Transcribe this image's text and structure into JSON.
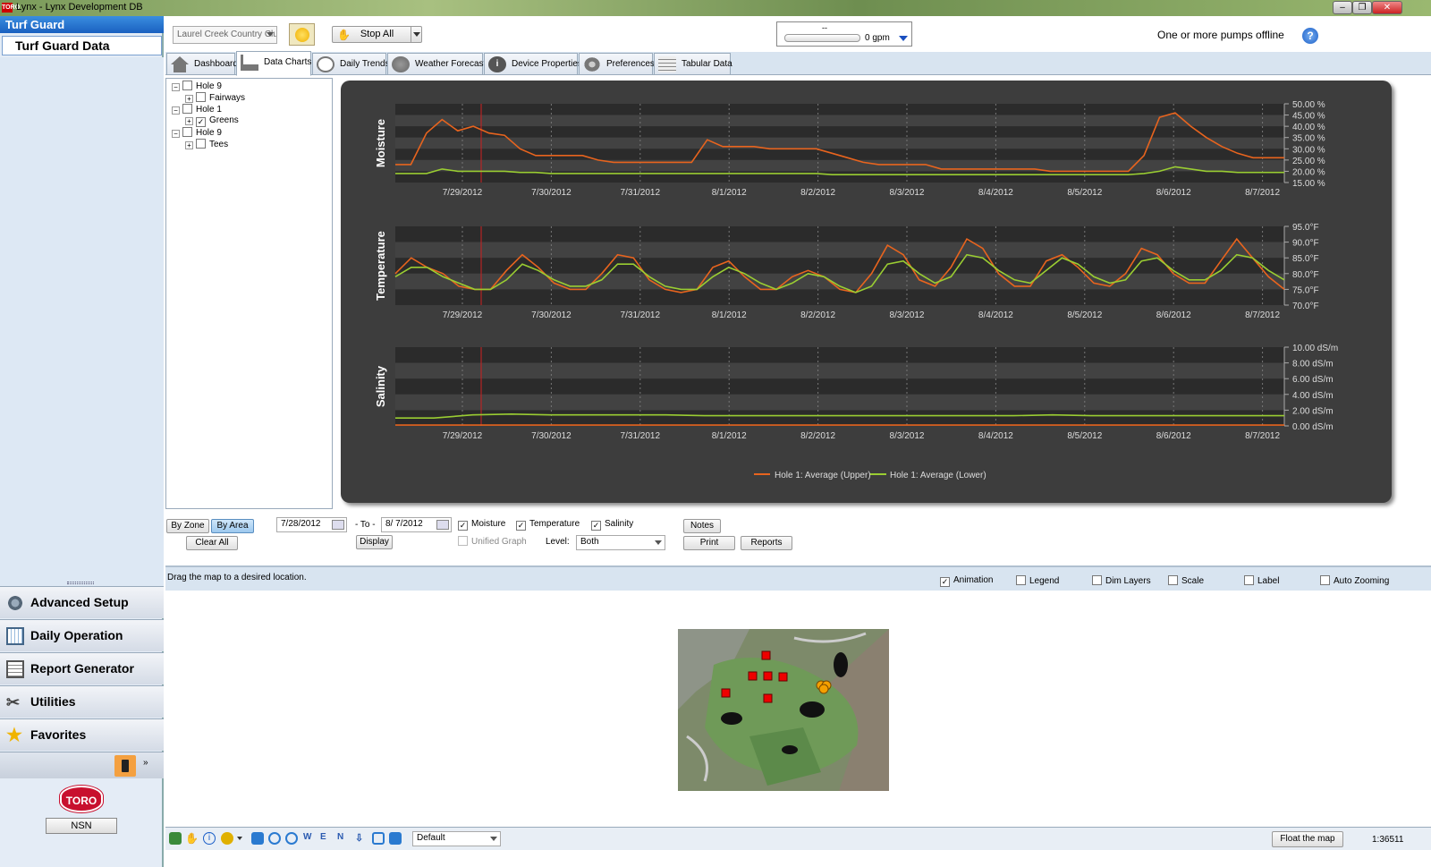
{
  "window": {
    "title": "Lynx - Lynx Development DB",
    "app_icon_text": "TORO"
  },
  "sidebar": {
    "header": "Turf Guard",
    "selected_item": "Turf Guard Data",
    "nav": [
      {
        "label": "Advanced Setup",
        "icon": "gear-icon"
      },
      {
        "label": "Daily Operation",
        "icon": "calendar-icon"
      },
      {
        "label": "Report Generator",
        "icon": "report-icon"
      },
      {
        "label": "Utilities",
        "icon": "tools-icon"
      },
      {
        "label": "Favorites",
        "icon": "star-icon"
      }
    ],
    "brand": "TORO",
    "nsn_label": "NSN"
  },
  "topbar": {
    "site_select": "Laurel Creek Country Club",
    "stop_all_label": "Stop All",
    "flow_top": "--",
    "flow_value": "0 gpm",
    "status": "One or more pumps offline"
  },
  "tabs": [
    {
      "label": "Dashboard",
      "icon": "home-icon"
    },
    {
      "label": "Data Charts",
      "icon": "chart-icon"
    },
    {
      "label": "Daily Trends",
      "icon": "clock-icon"
    },
    {
      "label": "Weather Forecast",
      "icon": "weather-icon"
    },
    {
      "label": "Device Properties",
      "icon": "info-icon"
    },
    {
      "label": "Preferences",
      "icon": "gears-icon"
    },
    {
      "label": "Tabular Data",
      "icon": "table-icon"
    }
  ],
  "tree": [
    {
      "label": "Hole 9",
      "checked": false,
      "level": 0
    },
    {
      "label": "Fairways",
      "checked": false,
      "level": 1
    },
    {
      "label": "Hole 1",
      "checked": false,
      "level": 0
    },
    {
      "label": "Greens",
      "checked": true,
      "level": 1
    },
    {
      "label": "Hole 9",
      "checked": false,
      "level": 0
    },
    {
      "label": "Tees",
      "checked": false,
      "level": 1
    }
  ],
  "chart_data": [
    {
      "type": "line",
      "ylabel": "Moisture",
      "x": [
        "7/29/2012",
        "7/30/2012",
        "7/31/2012",
        "8/1/2012",
        "8/2/2012",
        "8/3/2012",
        "8/4/2012",
        "8/5/2012",
        "8/6/2012",
        "8/7/2012"
      ],
      "y_ticks": [
        "50.00 %",
        "45.00 %",
        "40.00 %",
        "35.00 %",
        "30.00 %",
        "25.00 %",
        "20.00 %",
        "15.00 %"
      ],
      "ylim": [
        15,
        50
      ],
      "series": [
        {
          "name": "Hole 1: Average (Upper)",
          "color": "#e8641e",
          "values": [
            23,
            23,
            37,
            43,
            38,
            40,
            37,
            36,
            30,
            27,
            27,
            27,
            27,
            25,
            24,
            24,
            24,
            24,
            24,
            24,
            34,
            31,
            31,
            31,
            30,
            30,
            30,
            30,
            28,
            26,
            24,
            23,
            23,
            23,
            23,
            21,
            21,
            21,
            21,
            21,
            21,
            21,
            20,
            20,
            20,
            20,
            20,
            20,
            27,
            44,
            46,
            40,
            35,
            31,
            28,
            26,
            26,
            26
          ]
        },
        {
          "name": "Hole 1: Average (Lower)",
          "color": "#9acd32",
          "values": [
            19,
            19,
            19,
            21,
            20,
            20,
            20,
            20,
            19.5,
            19.5,
            19,
            19,
            19,
            19,
            19,
            19,
            19,
            19,
            19,
            19,
            19,
            19,
            19,
            19,
            19,
            19,
            19,
            19,
            18.5,
            18.5,
            18.5,
            18.5,
            18.5,
            18.5,
            18.5,
            18.5,
            18.5,
            18.5,
            18.5,
            18.5,
            18.5,
            18.5,
            18.5,
            18.5,
            18.5,
            18.5,
            18.5,
            18.5,
            19,
            20,
            22,
            21,
            20,
            20,
            19.5,
            19.5,
            19.5,
            19.5
          ]
        }
      ]
    },
    {
      "type": "line",
      "ylabel": "Temperature",
      "x": [
        "7/29/2012",
        "7/30/2012",
        "7/31/2012",
        "8/1/2012",
        "8/2/2012",
        "8/3/2012",
        "8/4/2012",
        "8/5/2012",
        "8/6/2012",
        "8/7/2012"
      ],
      "y_ticks": [
        "95.0°F",
        "90.0°F",
        "85.0°F",
        "80.0°F",
        "75.0°F",
        "70.0°F"
      ],
      "ylim": [
        70,
        95
      ],
      "series": [
        {
          "name": "Hole 1: Average (Upper)",
          "color": "#e8641e",
          "values": [
            80,
            85,
            82,
            80,
            76,
            75,
            75,
            81,
            86,
            82,
            77,
            75,
            75,
            80,
            86,
            85,
            78,
            75,
            74,
            75,
            82,
            84,
            79,
            75,
            75,
            79,
            81,
            79,
            75,
            74,
            80,
            89,
            86,
            78,
            76,
            82,
            91,
            88,
            80,
            76,
            76,
            84,
            86,
            82,
            77,
            76,
            80,
            88,
            86,
            80,
            77,
            77,
            84,
            91,
            85,
            79,
            75
          ]
        },
        {
          "name": "Hole 1: Average (Lower)",
          "color": "#9acd32",
          "values": [
            79,
            82,
            82,
            79,
            77,
            75,
            75,
            78,
            83,
            81,
            78,
            76,
            76,
            78,
            83,
            83,
            79,
            76,
            75,
            75,
            79,
            82,
            80,
            77,
            75,
            77,
            80,
            79,
            76,
            74,
            76,
            83,
            84,
            80,
            77,
            79,
            86,
            85,
            81,
            78,
            77,
            81,
            85,
            83,
            79,
            77,
            78,
            84,
            85,
            81,
            78,
            78,
            81,
            86,
            85,
            81,
            78
          ]
        }
      ]
    },
    {
      "type": "line",
      "ylabel": "Salinity",
      "x": [
        "7/29/2012",
        "7/30/2012",
        "7/31/2012",
        "8/1/2012",
        "8/2/2012",
        "8/3/2012",
        "8/4/2012",
        "8/5/2012",
        "8/6/2012",
        "8/7/2012"
      ],
      "y_ticks": [
        "10.00 dS/m",
        "8.00 dS/m",
        "6.00 dS/m",
        "4.00 dS/m",
        "2.00 dS/m",
        "0.00 dS/m"
      ],
      "ylim": [
        0,
        10
      ],
      "series": [
        {
          "name": "Hole 1: Average (Upper)",
          "color": "#e8641e",
          "values": [
            0.1,
            0.1,
            0.1,
            0.1,
            0.1,
            0.1,
            0.1,
            0.1,
            0.1,
            0.1,
            0.1,
            0.1
          ]
        },
        {
          "name": "Hole 1: Average (Lower)",
          "color": "#9acd32",
          "values": [
            1.0,
            1.0,
            1.4,
            1.5,
            1.4,
            1.4,
            1.4,
            1.4,
            1.3,
            1.3,
            1.3,
            1.3,
            1.3,
            1.3,
            1.3,
            1.3,
            1.3,
            1.4,
            1.3,
            1.3,
            1.3,
            1.3,
            1.3,
            1.3
          ]
        }
      ]
    }
  ],
  "legend": [
    "Hole 1: Average (Upper)",
    "Hole 1: Average (Lower)"
  ],
  "controls": {
    "by_zone": "By Zone",
    "by_area": "By Area",
    "clear_all": "Clear All",
    "from_date": "7/28/2012",
    "to_label": "- To -",
    "to_date": "8/  7/2012",
    "display": "Display",
    "moisture": "Moisture",
    "temperature": "Temperature",
    "salinity": "Salinity",
    "unified_graph": "Unified Graph",
    "level_label": "Level:",
    "level_value": "Both",
    "notes": "Notes",
    "print": "Print",
    "reports": "Reports"
  },
  "map": {
    "hint": "Drag the map to a desired location.",
    "options": [
      {
        "label": "Animation",
        "checked": true
      },
      {
        "label": "Legend",
        "checked": false
      },
      {
        "label": "Dim Layers",
        "checked": false
      },
      {
        "label": "Scale",
        "checked": false
      },
      {
        "label": "Label",
        "checked": false
      },
      {
        "label": "Auto Zooming",
        "checked": false
      }
    ],
    "layer_select": "Default",
    "float_button": "Float the map",
    "scale": "1:36511"
  }
}
